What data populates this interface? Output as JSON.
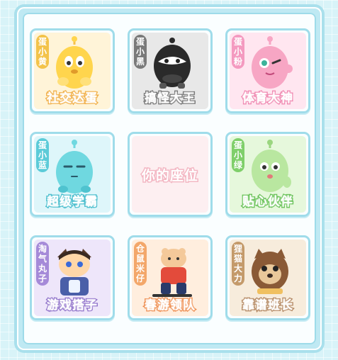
{
  "cards": [
    {
      "tag": "蛋小黄",
      "title": "社交达蛋",
      "tag_color": "#f3c34a",
      "title_color": "#f0a93a",
      "bg": "#fff4d8",
      "body": "#ffd54d",
      "accent": "#ffec9a"
    },
    {
      "tag": "蛋小黑",
      "title": "搞怪大王",
      "tag_color": "#7a7a7a",
      "title_color": "#6b6b6b",
      "bg": "#e8e8e8",
      "body": "#2a2a2a",
      "accent": "#ffffff"
    },
    {
      "tag": "蛋小粉",
      "title": "体育大神",
      "tag_color": "#f49ac0",
      "title_color": "#ef7fab",
      "bg": "#ffe6f0",
      "body": "#f7a6c4",
      "accent": "#ffffff"
    },
    {
      "tag": "蛋小蓝",
      "title": "超级学霸",
      "tag_color": "#5ccbd8",
      "title_color": "#39b8c9",
      "bg": "#def6fa",
      "body": "#6fd8e0",
      "accent": "#ffffff"
    },
    {
      "tag": "",
      "title": "你的座位",
      "tag_color": "",
      "title_color": "#f3b7c3",
      "bg": "#fdeff1",
      "body": "",
      "accent": ""
    },
    {
      "tag": "蛋小绿",
      "title": "贴心伙伴",
      "tag_color": "#7fcf6a",
      "title_color": "#5cbd4a",
      "bg": "#e6f8dc",
      "body": "#b9e7a0",
      "accent": "#ffffff"
    },
    {
      "tag": "淘气丸子",
      "title": "游戏搭子",
      "tag_color": "#a58ad8",
      "title_color": "#8b6cc8",
      "bg": "#eee6fa",
      "body": "#4a5fa8",
      "accent": "#ffd7a8"
    },
    {
      "tag": "仓鼠米仔",
      "title": "春游领队",
      "tag_color": "#f3a76a",
      "title_color": "#ee8a4a",
      "bg": "#ffeede",
      "body": "#e34b3b",
      "accent": "#ffffff"
    },
    {
      "tag": "狸猫大力",
      "title": "靠谱班长",
      "tag_color": "#c49a6a",
      "title_color": "#b0825a",
      "bg": "#f7ecdc",
      "body": "#8a5a36",
      "accent": "#f0c060"
    }
  ]
}
